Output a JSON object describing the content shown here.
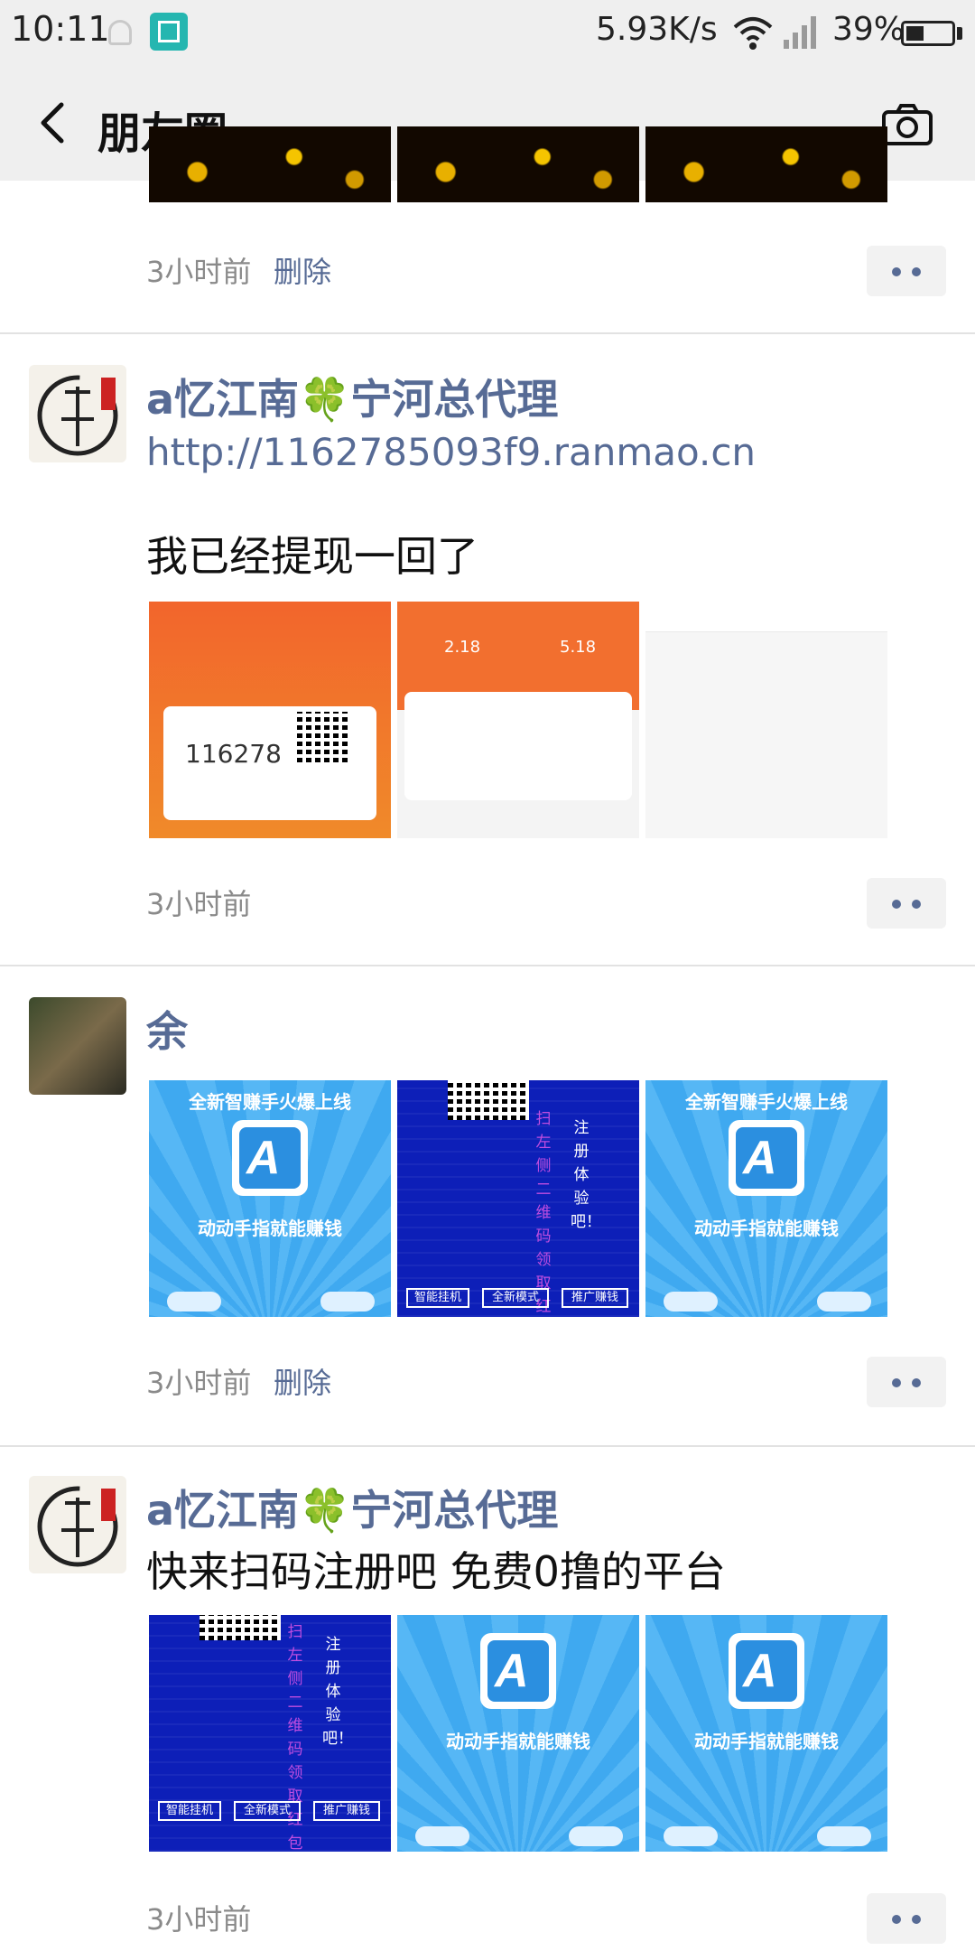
{
  "status_bar": {
    "time": "10:11",
    "net_speed": "5.93K/s",
    "battery_pct": "39%",
    "battery_level": 0.39
  },
  "nav": {
    "title": "朋友圈",
    "back_icon": "chevron-left-icon",
    "camera_icon": "camera-icon"
  },
  "posts": [
    {
      "time": "3小时前",
      "delete_label": "删除"
    },
    {
      "nickname": "a忆江南🍀宁河总代理",
      "link": "http://1162785093f9.ranmao.cn",
      "text": "我已经提现一回了",
      "time": "3小时前",
      "images": {
        "orange_number": "116278",
        "phone_value_a": "2.18",
        "phone_value_b": "5.18"
      }
    },
    {
      "nickname": "余",
      "time": "3小时前",
      "delete_label": "删除",
      "images": {
        "banner_top": "全新智赚手火爆上线",
        "banner_bottom": "动动手指就能赚钱",
        "vert_pink": "扫左侧二维码领取红包",
        "vert_white": "注册体验吧！",
        "btn1": "智能挂机",
        "btn2": "全新模式",
        "btn3": "推广赚钱"
      }
    },
    {
      "nickname": "a忆江南🍀宁河总代理",
      "text": "快来扫码注册吧  免费0撸的平台",
      "time": "3小时前",
      "images": {
        "banner_bottom": "动动手指就能赚钱"
      }
    }
  ],
  "colors": {
    "link_blue": "#576b95",
    "nav_bg": "#efefef"
  }
}
